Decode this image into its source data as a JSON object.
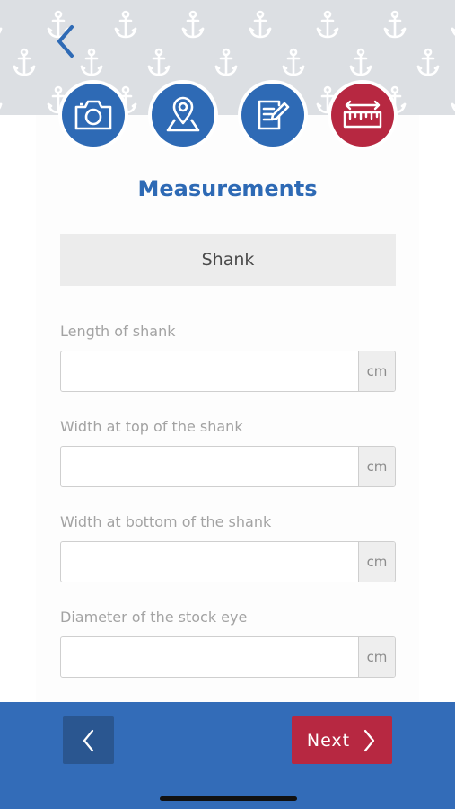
{
  "header": {
    "back_icon": "chevron-left-icon"
  },
  "steps": [
    {
      "icon": "camera-icon",
      "color": "#2e6ab5",
      "active": false
    },
    {
      "icon": "map-pin-icon",
      "color": "#2e6ab5",
      "active": false
    },
    {
      "icon": "edit-document-icon",
      "color": "#2e6ab5",
      "active": false
    },
    {
      "icon": "ruler-icon",
      "color": "#b72841",
      "active": true
    }
  ],
  "page": {
    "title": "Measurements",
    "section": "Shank"
  },
  "fields": [
    {
      "label": "Length of shank",
      "value": "",
      "unit": "cm"
    },
    {
      "label": "Width at top of the shank",
      "value": "",
      "unit": "cm"
    },
    {
      "label": "Width at bottom of the shank",
      "value": "",
      "unit": "cm"
    },
    {
      "label": "Diameter of the stock eye",
      "value": "",
      "unit": "cm"
    }
  ],
  "footer": {
    "prev_icon": "chevron-left-icon",
    "next_label": "Next",
    "next_icon": "chevron-right-icon"
  },
  "colors": {
    "brand_blue": "#2e6ab5",
    "footer_blue": "#336cb8",
    "accent_red": "#b72841"
  }
}
